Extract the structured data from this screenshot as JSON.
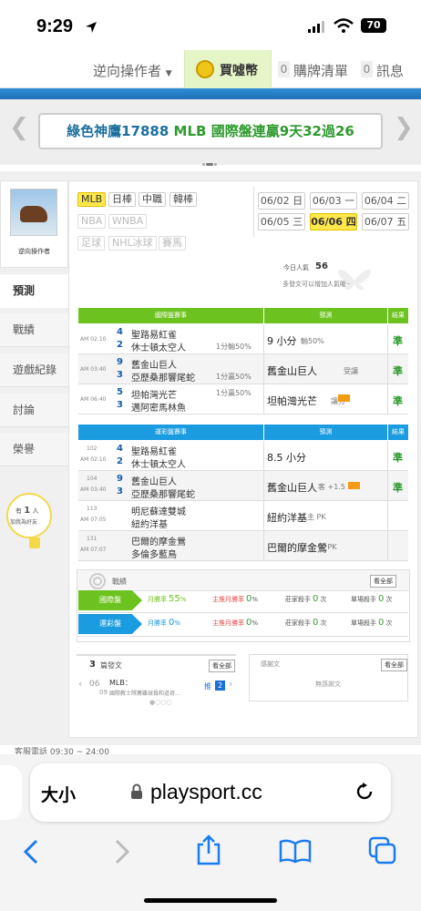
{
  "status_bar": {
    "time": "9:29",
    "battery": "70"
  },
  "top_nav": {
    "dropdown_label": "逆向操作者",
    "coin_label": "買噓幣",
    "cart_count": "0",
    "cart_label": "購牌清單",
    "msg_count": "0",
    "msg_label": "訊息"
  },
  "banner": {
    "prefix": "綠色神鷹17888",
    "mlb": "MLB",
    "rest": "國際盤連贏9天32過26"
  },
  "user": {
    "name": "逆向操作者"
  },
  "side_tabs": [
    "預測",
    "戰績",
    "遊戲紀錄",
    "討論",
    "榮譽"
  ],
  "side_bulb": {
    "line1": "有",
    "count": "1",
    "line1b": "人",
    "line2": "加我為好友"
  },
  "sport_tags": {
    "row1": [
      "MLB",
      "日棒",
      "中職",
      "韓棒"
    ],
    "row2": [
      "NBA",
      "WNBA"
    ],
    "row3": [
      "足球",
      "NHL冰球",
      "賽馬"
    ]
  },
  "dates": {
    "row1": [
      "06/02 日",
      "06/03 一",
      "06/04 二"
    ],
    "row2": [
      "06/05 三",
      "06/06 四",
      "06/07 五"
    ]
  },
  "popularity": {
    "label": "今日人氣",
    "value": "56",
    "hint": "多發文可以增加人氣喔→"
  },
  "intl_table": {
    "h1": "國際盤賽事",
    "h2": "預測",
    "h3": "結果",
    "rows": [
      {
        "t1": "AM 02:10",
        "n1": "4",
        "n2": "2",
        "team1": "聖路易紅雀",
        "team2": "休士頓太空人",
        "line": "1分輸50%",
        "pred": "9 小分",
        "pred_sub": "輸50%",
        "result": "準"
      },
      {
        "t1": "AM 03:40",
        "n1": "9",
        "n2": "3",
        "team1": "舊金山巨人",
        "team2": "亞歷桑那響尾蛇",
        "line": "1分贏50%",
        "pred": "舊金山巨人",
        "pred_sub": "受讓",
        "result": "準"
      },
      {
        "t1": "AM 06:40",
        "n1": "5",
        "n2": "3",
        "team1": "坦帕灣光芒",
        "team2": "邁阿密馬林魚",
        "line": "1分贏50%",
        "pred": "坦帕灣光芒",
        "pred_sub": "讓分",
        "result": "準"
      }
    ]
  },
  "lottery_table": {
    "h1": "運彩盤賽事",
    "h2": "預測",
    "h3": "結果",
    "rows": [
      {
        "id": "102",
        "t1": "AM 02:10",
        "n1": "4",
        "n2": "2",
        "team1": "聖路易紅雀",
        "team2": "休士頓太空人",
        "pred": "8.5 小分",
        "pred_sub": "",
        "result": "準"
      },
      {
        "id": "104",
        "t1": "AM 03:40",
        "n1": "9",
        "n2": "3",
        "team1": "舊金山巨人",
        "team2": "亞歷桑那響尾蛇",
        "pred": "舊金山巨人",
        "pred_sub": "客 +1.5",
        "result": "準"
      },
      {
        "id": "113",
        "t1": "AM 07:05",
        "n1": "",
        "n2": "",
        "team1": "明尼蘇達雙城",
        "team2": "紐約洋基",
        "pred": "紐約洋基",
        "pred_sub": "主 PK",
        "result": ""
      },
      {
        "id": "131",
        "t1": "AM 07:07",
        "n1": "",
        "n2": "",
        "team1": "巴爾的摩金鶯",
        "team2": "多倫多藍鳥",
        "pred": "巴爾的摩金鶯",
        "pred_sub": "客 PK",
        "result": ""
      }
    ]
  },
  "record": {
    "title": "戰績",
    "view_all": "看全部",
    "intl": {
      "label": "國際盤",
      "month_rate": "月勝率",
      "month_val": "55",
      "pct": "%",
      "home_rate": "主推月勝率",
      "home_val": "0",
      "dealer": "莊家殺手",
      "dealer_val": "0",
      "single": "單場殺手",
      "single_val": "0",
      "unit": "次"
    },
    "lottery": {
      "label": "運彩盤",
      "month_rate": "月勝率",
      "month_val": "0",
      "pct": "%",
      "home_rate": "主推月勝率",
      "home_val": "0",
      "dealer": "莊家殺手",
      "dealer_val": "0",
      "single": "單場殺手",
      "single_val": "0",
      "unit": "次"
    }
  },
  "posts": {
    "count": "3",
    "label": "篇發文",
    "view_all": "看全部",
    "date_m": "06",
    "date_d": "09",
    "post_title": "MLB：",
    "post_body": "國際教士隊賽雖球員和道奇…",
    "badge": "2",
    "tag": "推"
  },
  "replies": {
    "title": "感謝文",
    "view_all": "看全部",
    "empty": "無感謝文"
  },
  "footer": {
    "service": "客服電話 09:30 ~ 24:00"
  },
  "safari": {
    "size": "大小",
    "url": "playsport.cc"
  },
  "colors": {
    "green": "#6cc21e",
    "blue": "#1b9be0",
    "yellow": "#ffe84c"
  }
}
